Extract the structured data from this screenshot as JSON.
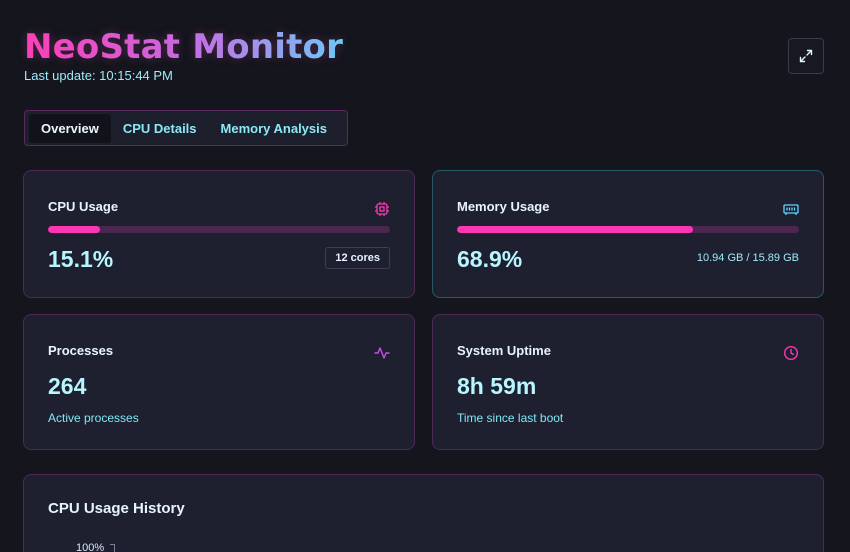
{
  "app": {
    "title": "NeoStat Monitor",
    "last_update": "Last update: 10:15:44 PM",
    "expand_icon": "expand-icon"
  },
  "tabs": [
    {
      "label": "Overview",
      "active": true
    },
    {
      "label": "CPU Details",
      "active": false
    },
    {
      "label": "Memory Analysis",
      "active": false
    }
  ],
  "cards": {
    "cpu": {
      "title": "CPU Usage",
      "icon": "cpu-icon",
      "value": "15.1%",
      "percent": 15.1,
      "badge": "12 cores"
    },
    "memory": {
      "title": "Memory Usage",
      "icon": "memory-icon",
      "value": "68.9%",
      "percent": 68.9,
      "detail": "10.94 GB / 15.89 GB"
    },
    "processes": {
      "title": "Processes",
      "icon": "activity-icon",
      "value": "264",
      "subtitle": "Active processes"
    },
    "uptime": {
      "title": "System Uptime",
      "icon": "clock-icon",
      "value": "8h 59m",
      "subtitle": "Time since last boot"
    }
  },
  "history": {
    "title": "CPU Usage History",
    "top_tick": "100%"
  },
  "colors": {
    "accent_pink": "#ff36b4",
    "accent_cyan": "#5fd7ff",
    "background": "#14151d",
    "card": "#1e2030"
  }
}
